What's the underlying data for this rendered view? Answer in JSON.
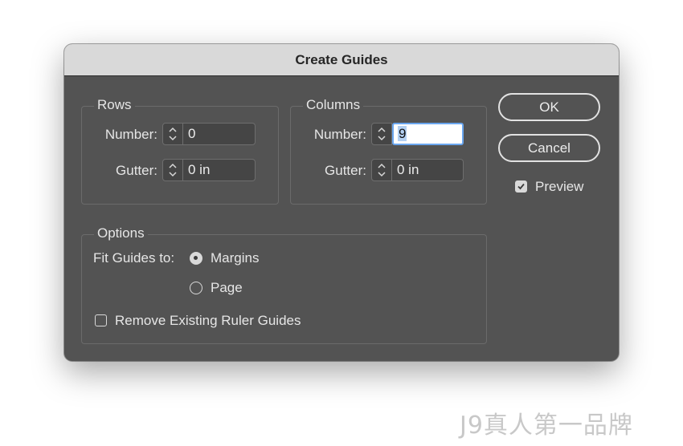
{
  "dialog": {
    "title": "Create Guides"
  },
  "rows": {
    "label": "Rows",
    "number_label": "Number:",
    "number_value": "0",
    "gutter_label": "Gutter:",
    "gutter_value": "0 in"
  },
  "columns": {
    "label": "Columns",
    "number_label": "Number:",
    "number_value": "9",
    "gutter_label": "Gutter:",
    "gutter_value": "0 in"
  },
  "buttons": {
    "ok": "OK",
    "cancel": "Cancel"
  },
  "preview": {
    "label": "Preview",
    "checked": true
  },
  "options": {
    "label": "Options",
    "fit_label": "Fit Guides to:",
    "margins_label": "Margins",
    "page_label": "Page",
    "selected": "Margins",
    "remove_label": "Remove Existing Ruler Guides",
    "remove_checked": false
  },
  "watermark": "J9真人第一品牌",
  "colors": {
    "dialog_bg": "#535353",
    "titlebar_bg": "#d9d9d9",
    "focus_ring": "#6aa6ef"
  }
}
